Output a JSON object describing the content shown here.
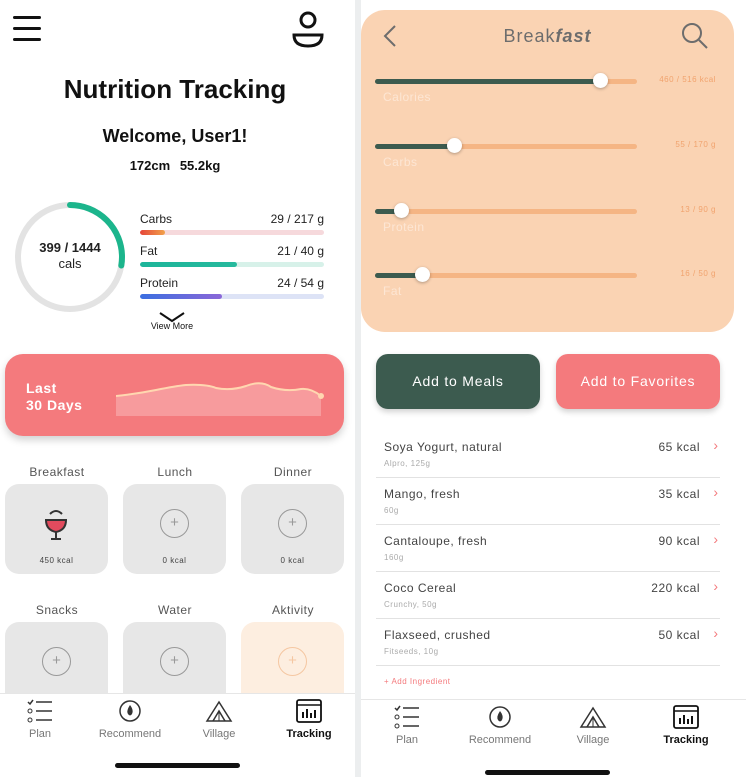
{
  "left": {
    "title": "Nutrition Tracking",
    "welcome": "Welcome, User1!",
    "height": "172cm",
    "weight": "55.2kg",
    "calories": {
      "value": "399 / 1444",
      "unit": "cals",
      "progress": 0.276
    },
    "macros": [
      {
        "name": "Carbs",
        "value": "29 / 217 g",
        "progress": 0.134,
        "color_from": "#e5453a",
        "color_to": "#f1a14a",
        "track": "#f6d9dc"
      },
      {
        "name": "Fat",
        "value": "21 / 40 g",
        "progress": 0.525,
        "color_from": "#1cb59a",
        "color_to": "#26b99d",
        "track": "#d7f1e9"
      },
      {
        "name": "Protein",
        "value": "24 / 54 g",
        "progress": 0.444,
        "color_from": "#3b6fe0",
        "color_to": "#8b67d8",
        "track": "#dde3f6"
      }
    ],
    "view_more": "View More",
    "last30_line1": "Last",
    "last30_line2": "30 Days",
    "meals": [
      {
        "label": "Breakfast",
        "kcal": "450 kcal",
        "icon": "bowl-icon"
      },
      {
        "label": "Lunch",
        "kcal": "0 kcal",
        "icon": "plus-icon"
      },
      {
        "label": "Dinner",
        "kcal": "0 kcal",
        "icon": "plus-icon"
      },
      {
        "label": "Snacks",
        "icon": "plus-icon"
      },
      {
        "label": "Water",
        "icon": "plus-icon"
      },
      {
        "label": "Aktivity",
        "icon": "plus-icon"
      }
    ],
    "nav": [
      {
        "label": "Plan",
        "icon": "checklist-icon"
      },
      {
        "label": "Recommend",
        "icon": "flame-icon"
      },
      {
        "label": "Village",
        "icon": "village-icon"
      },
      {
        "label": "Tracking",
        "icon": "chart-icon",
        "active": true
      }
    ]
  },
  "right": {
    "title_light": "Break",
    "title_bold": "fast",
    "sliders": [
      {
        "label": "Calories",
        "value": "460 / 516 kcal",
        "progress": 0.86
      },
      {
        "label": "Carbs",
        "value": "55 / 170 g",
        "progress": 0.3
      },
      {
        "label": "Protein",
        "value": "13 / 90 g",
        "progress": 0.1
      },
      {
        "label": "Fat",
        "value": "16 / 50 g",
        "progress": 0.18
      }
    ],
    "add_meals": "Add to Meals",
    "add_favorites": "Add to Favorites",
    "foods": [
      {
        "name": "Soya Yogurt, natural",
        "sub": "Alpro, 125g",
        "kcal": "65 kcal"
      },
      {
        "name": "Mango, fresh",
        "sub": "60g",
        "kcal": "35 kcal"
      },
      {
        "name": "Cantaloupe, fresh",
        "sub": "160g",
        "kcal": "90 kcal"
      },
      {
        "name": "Coco Cereal",
        "sub": "Crunchy, 50g",
        "kcal": "220 kcal"
      },
      {
        "name": "Flaxseed, crushed",
        "sub": "Fitseeds, 10g",
        "kcal": "50 kcal"
      }
    ],
    "add_ingredient": "+ Add Ingredient",
    "nav": [
      {
        "label": "Plan",
        "icon": "checklist-icon"
      },
      {
        "label": "Recommend",
        "icon": "flame-icon"
      },
      {
        "label": "Village",
        "icon": "village-icon"
      },
      {
        "label": "Tracking",
        "icon": "chart-icon",
        "active": true
      }
    ]
  },
  "colors": {
    "coral": "#f47a7d",
    "dark_green": "#3c5b4f",
    "peach": "#fad3b3",
    "ring": "#1cb58c"
  }
}
